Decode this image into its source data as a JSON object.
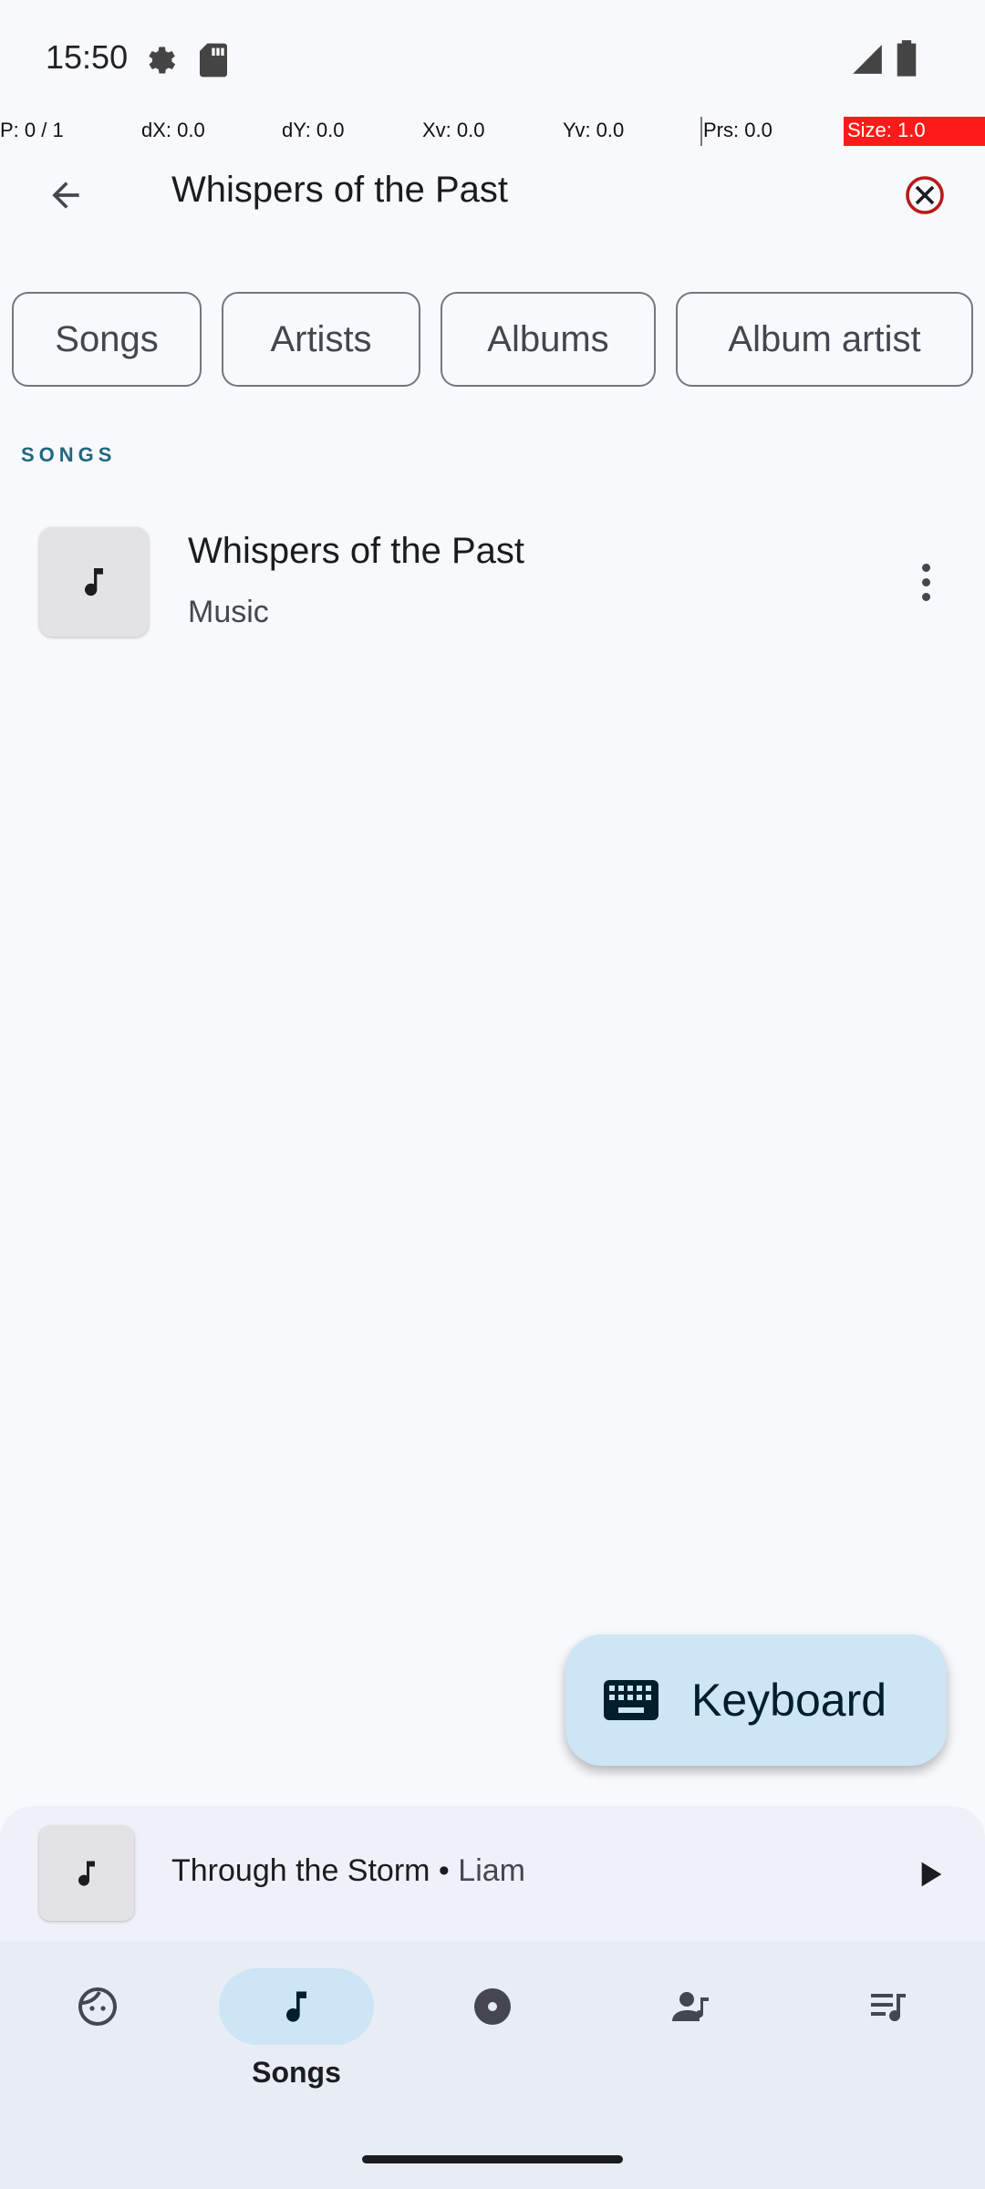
{
  "status_bar": {
    "time": "15:50",
    "icons": [
      "settings-gear-icon",
      "sd-card-icon",
      "signal-icon",
      "battery-icon"
    ]
  },
  "debug_overlay": {
    "pointer": "P: 0 / 1",
    "dx": "dX: 0.0",
    "dy": "dY: 0.0",
    "xv": "Xv: 0.0",
    "yv": "Yv: 0.0",
    "prs": "Prs: 0.0",
    "size": "Size: 1.0"
  },
  "search": {
    "query": "Whispers of the Past"
  },
  "filters": {
    "chips": [
      {
        "label": "Songs"
      },
      {
        "label": "Artists"
      },
      {
        "label": "Albums"
      },
      {
        "label": "Album artist"
      }
    ]
  },
  "results": {
    "section_title": "SONGS",
    "items": [
      {
        "title": "Whispers of the Past",
        "subtitle": "Music"
      }
    ]
  },
  "fab": {
    "label": "Keyboard"
  },
  "mini_player": {
    "title": "Through the Storm",
    "separator": " • ",
    "artist": "Liam"
  },
  "bottom_nav": {
    "items": [
      {
        "label": "",
        "icon": "face-icon"
      },
      {
        "label": "Songs",
        "icon": "music-note-icon",
        "active": true
      },
      {
        "label": "",
        "icon": "album-icon"
      },
      {
        "label": "",
        "icon": "artist-icon"
      },
      {
        "label": "",
        "icon": "playlist-icon"
      }
    ]
  },
  "colors": {
    "accent": "#1f6780",
    "active_pill": "#cde5f5",
    "debug_red": "#ff1a1a"
  }
}
